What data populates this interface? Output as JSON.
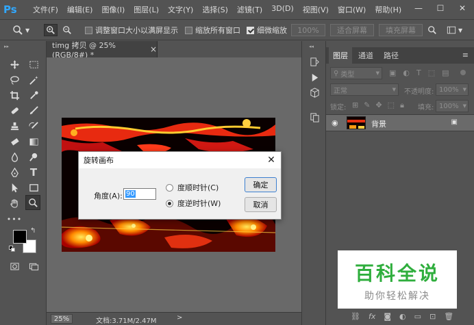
{
  "app": {
    "logo": "Ps"
  },
  "menu": [
    "文件(F)",
    "编辑(E)",
    "图像(I)",
    "图层(L)",
    "文字(Y)",
    "选择(S)",
    "滤镜(T)",
    "3D(D)",
    "视图(V)",
    "窗口(W)",
    "帮助(H)"
  ],
  "window_controls": {
    "minimize": "—",
    "maximize": "☐",
    "close": "✕"
  },
  "options": {
    "resize_windows": "调整窗口大小以满屏显示",
    "zoom_all": "缩放所有窗口",
    "scrubby_zoom": "细微缩放",
    "zoom_percent_btn": "100%",
    "fit_screen_btn": "适合屏幕",
    "fill_screen_btn": "填充屏幕"
  },
  "document": {
    "tab_title": "timg 拷贝 @ 25%(RGB/8#) *",
    "tab_close": "×",
    "zoom": "25%",
    "doc_info": "文档:3.71M/2.47M"
  },
  "dialog": {
    "title": "旋转画布",
    "close": "✕",
    "angle_label": "角度(A):",
    "angle_value": "90",
    "cw_label": "度顺时针(C)",
    "ccw_label": "度逆时针(W)",
    "ok": "确定",
    "cancel": "取消"
  },
  "layers_panel": {
    "tabs": [
      "图层",
      "通道",
      "路径"
    ],
    "filter_kind": "类型",
    "blend_mode": "正常",
    "opacity_label": "不透明度:",
    "opacity_value": "100%",
    "lock_label": "锁定:",
    "fill_label": "填充:",
    "fill_value": "100%",
    "layer_name": "背景"
  },
  "watermark": {
    "title": "百科全说",
    "subtitle": "助你轻松解决"
  },
  "colors": {
    "accent": "#31a8ff",
    "watermark_green": "#2fae3d"
  }
}
